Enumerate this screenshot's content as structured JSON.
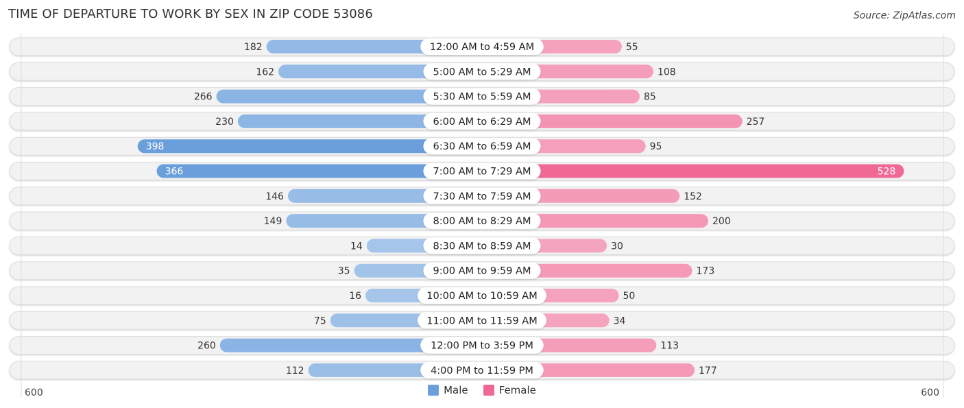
{
  "header": {
    "title": "TIME OF DEPARTURE TO WORK BY SEX IN ZIP CODE 53086",
    "source": "Source: ZipAtlas.com"
  },
  "legend": {
    "male_label": "Male",
    "female_label": "Female"
  },
  "colors": {
    "male": "#6a9fdc",
    "male_light": "#a7c6ea",
    "female": "#f06894",
    "female_light": "#f5a6c0",
    "row_bg": "#f2f2f2"
  },
  "chart_data": {
    "type": "bar",
    "orientation": "horizontal-diverging",
    "title": "TIME OF DEPARTURE TO WORK BY SEX IN ZIP CODE 53086",
    "categories": [
      "12:00 AM to 4:59 AM",
      "5:00 AM to 5:29 AM",
      "5:30 AM to 5:59 AM",
      "6:00 AM to 6:29 AM",
      "6:30 AM to 6:59 AM",
      "7:00 AM to 7:29 AM",
      "7:30 AM to 7:59 AM",
      "8:00 AM to 8:29 AM",
      "8:30 AM to 8:59 AM",
      "9:00 AM to 9:59 AM",
      "10:00 AM to 10:59 AM",
      "11:00 AM to 11:59 AM",
      "12:00 PM to 3:59 PM",
      "4:00 PM to 11:59 PM"
    ],
    "series": [
      {
        "name": "Male",
        "values": [
          182,
          162,
          266,
          230,
          398,
          366,
          146,
          149,
          14,
          35,
          16,
          75,
          260,
          112
        ]
      },
      {
        "name": "Female",
        "values": [
          55,
          108,
          85,
          257,
          95,
          528,
          152,
          200,
          30,
          173,
          50,
          34,
          113,
          177
        ]
      }
    ],
    "axis": {
      "left_label": "600",
      "right_label": "600",
      "range": [
        0,
        600
      ]
    },
    "legend_position": "bottom-center"
  }
}
